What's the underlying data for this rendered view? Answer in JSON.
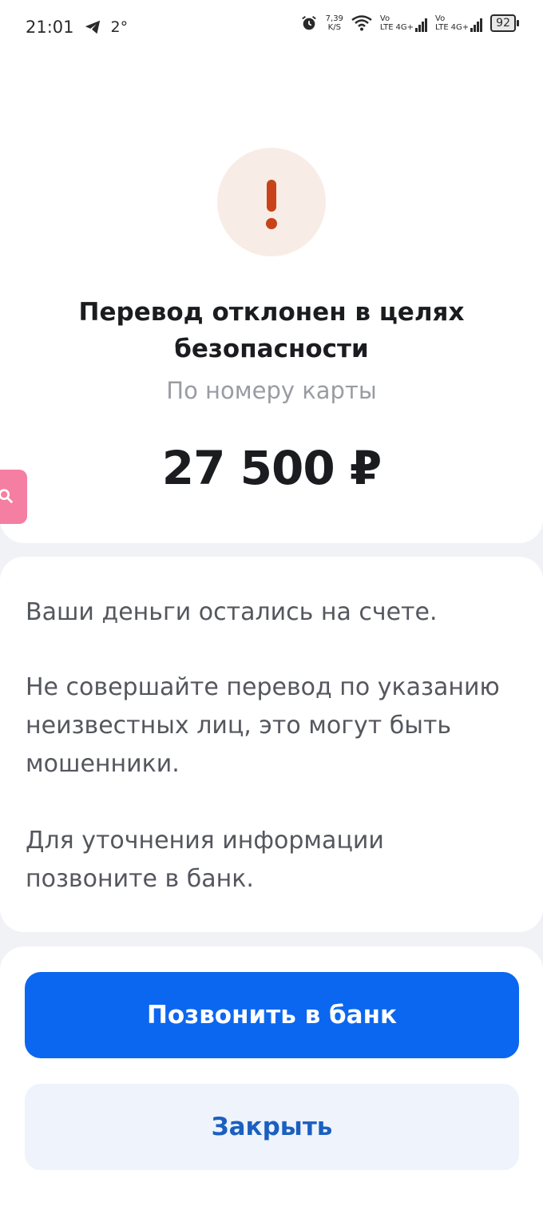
{
  "status_bar": {
    "time": "21:01",
    "temperature": "2°",
    "net_speed_value": "7,39",
    "net_speed_unit": "K/S",
    "volte_1": "Vo",
    "lte_1": "LTE",
    "g4_1": "4G+",
    "volte_2": "Vo",
    "lte_2": "LTE",
    "g4_2": "4G+",
    "battery": "92",
    "icons": [
      "telegram-icon",
      "alarm-icon",
      "wifi-icon",
      "signal-icon",
      "battery-icon"
    ]
  },
  "result": {
    "title": "Перевод отклонен в целях безопасности",
    "subtitle": "По номеру карты",
    "amount": "27 500 ₽",
    "status_color": "#c9431a"
  },
  "info": {
    "line_1": "Ваши деньги остались на счете.",
    "line_2": "Не совершайте перевод по указанию неизвестных лиц, это могут быть мошенники.",
    "line_3": "Для уточнения информации позвоните в банк."
  },
  "actions": {
    "call_bank_label": "Позвонить в банк",
    "close_label": "Закрыть",
    "primary_color": "#0b67f0"
  }
}
